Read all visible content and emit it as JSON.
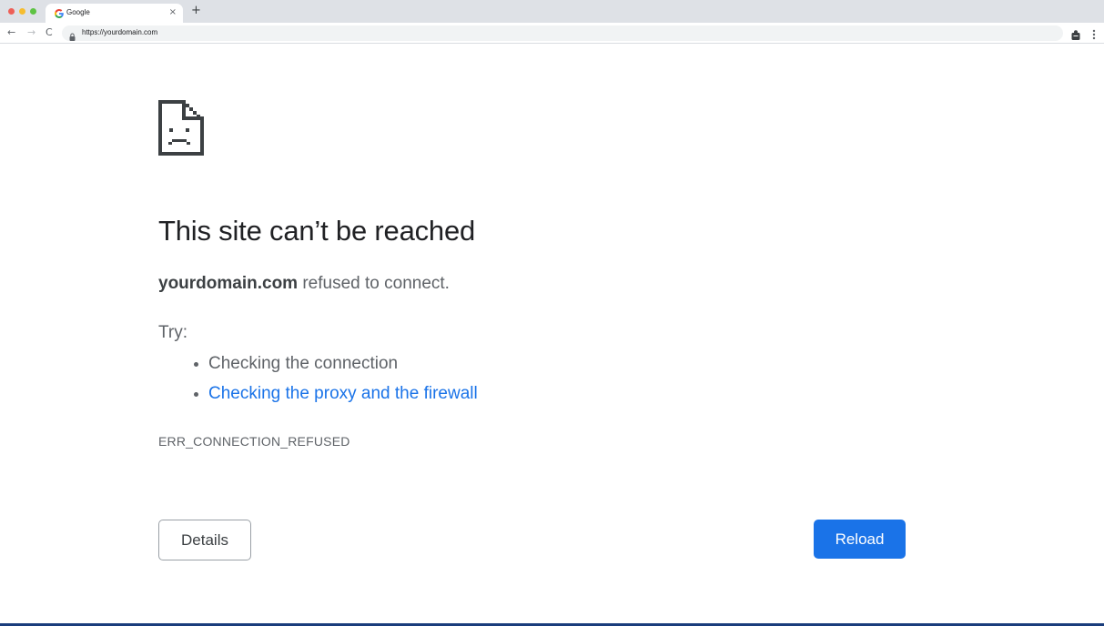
{
  "browser": {
    "tab": {
      "title": "Google",
      "close_glyph": "×",
      "favicon": "google-g-icon"
    },
    "new_tab_glyph": "+",
    "nav": {
      "back_glyph": "←",
      "forward_glyph": "→",
      "reload_glyph": "C"
    },
    "address": {
      "url": "https://yourdomain.com",
      "lock_icon": "lock-icon"
    }
  },
  "error_page": {
    "icon": "sad-page-icon",
    "heading": "This site can’t be reached",
    "domain": "yourdomain.com",
    "summary_rest": " refused to connect.",
    "try_label": "Try:",
    "suggestions": [
      {
        "text": "Checking the connection",
        "is_link": false
      },
      {
        "text": "Checking the proxy and the firewall",
        "is_link": true
      }
    ],
    "error_code": "ERR_CONNECTION_REFUSED",
    "details_label": "Details",
    "reload_label": "Reload"
  },
  "colors": {
    "link": "#1a73e8",
    "reload_button": "#1a73e8",
    "text_primary": "#202124",
    "text_secondary": "#5f6368"
  }
}
